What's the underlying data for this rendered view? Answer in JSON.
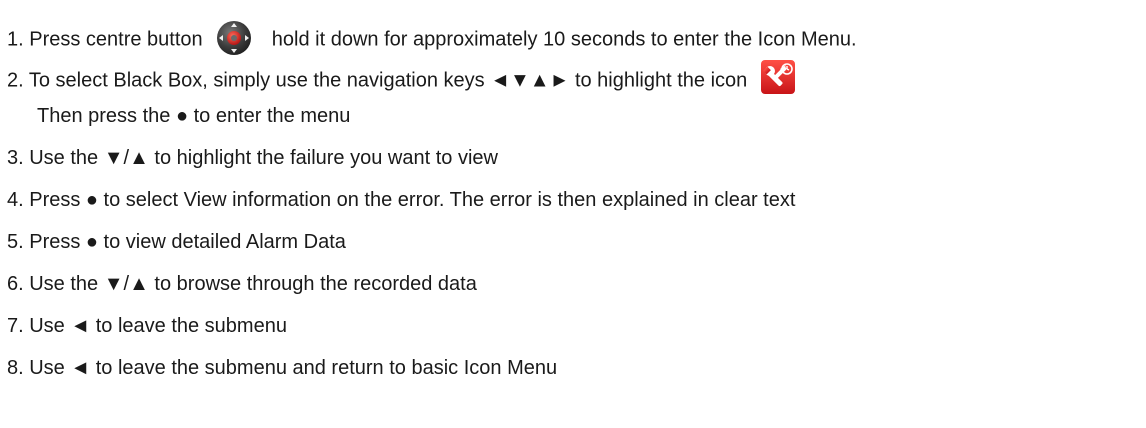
{
  "instructions": {
    "step1": {
      "before": "1. Press centre button",
      "after": "hold it down for approximately 10 seconds to enter the Icon Menu."
    },
    "step2": {
      "text": "2. To select Black Box, simply use the navigation keys ◄▼▲► to highlight the icon",
      "continuation": "Then press the ● to enter the menu"
    },
    "step3": "3. Use the ▼/▲ to highlight the failure you want to view",
    "step4": "4. Press ● to select View information on the error. The error is then explained in clear text",
    "step5": "5. Press ● to view detailed Alarm Data",
    "step6": "6. Use the ▼/▲ to browse through the recorded data",
    "step7": "7. Use ◄ to leave the submenu",
    "step8": "8. Use ◄ to leave the submenu and return to basic Icon Menu"
  },
  "icons": {
    "nav_button": "navigation-pad-icon",
    "black_box": "wrench-clock-icon"
  },
  "colors": {
    "text": "#1a1a1a",
    "nav_button_body": "#3c3c3c",
    "nav_button_center": "#d21e1e",
    "black_box_bg": "#e8262a"
  }
}
